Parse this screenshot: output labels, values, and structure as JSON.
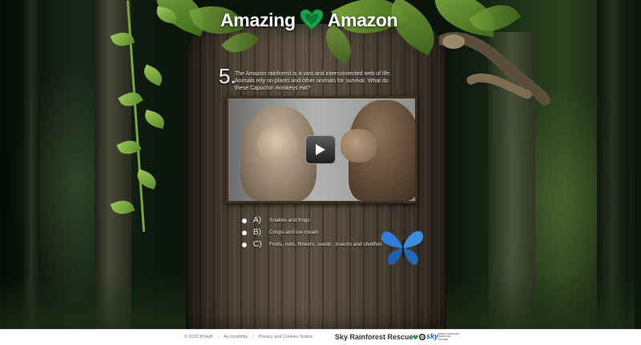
{
  "header": {
    "logo_left": "Amazing",
    "logo_right": "Amazon",
    "logo_icon": "heart-icon",
    "accent": "#1aa34a"
  },
  "question": {
    "number": "5.",
    "text": "The Amazon rainforest is a vast and interconnected web of life. Animals rely on plants and other animals for survival. What do these Capuchin monkeys eat?"
  },
  "video": {
    "play_icon": "play-icon"
  },
  "answers": [
    {
      "letter": "A)",
      "text": "Snakes and frogs"
    },
    {
      "letter": "B)",
      "text": "Crisps and ice-cream"
    },
    {
      "letter": "C)",
      "text": "Fruits, nuts, flowers, seeds , insects and shellfish"
    }
  ],
  "footer": {
    "copyright": "© 2013 BSkyB",
    "link_accessibility": "Accessibility",
    "link_privacy": "Privacy and Cookies Notice",
    "brand": "Sky Rainforest Rescue",
    "sky_logo": "sky",
    "partner_text": "WORLD WILDLIFE FUND FOR NATURE"
  }
}
